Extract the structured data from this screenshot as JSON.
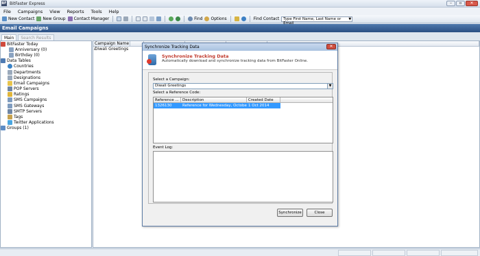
{
  "window": {
    "app_icon": "BF",
    "title": "BitFaster Express",
    "min": "–",
    "max": "▫",
    "close": "✕"
  },
  "menu": [
    "File",
    "Campaigns",
    "View",
    "Reports",
    "Tools",
    "Help"
  ],
  "toolbar": {
    "new_contact": "New Contact",
    "new_group": "New Group",
    "contact_manager": "Contact Manager",
    "find": "Find",
    "options": "Options",
    "find_contact_label": "Find Contact",
    "find_contact_placeholder": "Type First Name, Last Name or Email"
  },
  "banner": "Email Campaigns",
  "tabs": {
    "main": "Main",
    "search_results": "Search Results"
  },
  "tree": {
    "today": "BitFaster Today",
    "anniversary": "Anniversary (0)",
    "birthday": "Birthday (0)",
    "data_tables": "Data Tables",
    "countries": "Countries",
    "departments": "Departments",
    "designations": "Designations",
    "email_campaigns": "Email Campaigns",
    "pop_servers": "POP Servers",
    "ratings": "Ratings",
    "sms_campaigns": "SMS Campaigns",
    "sms_gateways": "SMS Gateways",
    "smtp_servers": "SMTP Servers",
    "tags": "Tags",
    "twitter": "Twitter Applications",
    "groups": "Groups (1)"
  },
  "main": {
    "col_campaign_name": "Campaign Name",
    "row1": "Diwali Greetings"
  },
  "dialog": {
    "title": "Synchronize Tracking Data",
    "close": "✕",
    "heading": "Synchronize Tracking Data",
    "subheading": "Automatically download and synchronize tracking data from BitFaster Online.",
    "select_campaign_label": "Select a Campaign:",
    "campaign_value": "Diwali Greetings",
    "select_ref_label": "Select a Reference Code:",
    "grid_headers": [
      "Reference ...",
      "Description",
      "Created Date"
    ],
    "grid_row": [
      "1326130",
      "Reference for Wednesday, Octobe...",
      "1 Oct 2014"
    ],
    "event_log_label": "Event Log:",
    "synchronize_button": "Synchronize",
    "close_button": "Close"
  }
}
